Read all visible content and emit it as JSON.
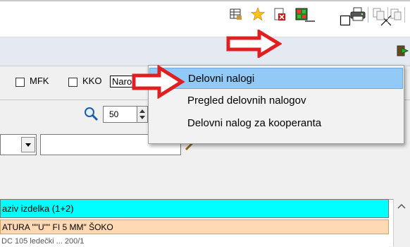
{
  "window": {
    "minimize_icon": "minimize-icon",
    "maximize_icon": "maximize-icon",
    "close_icon": "close-icon"
  },
  "toolbar": {
    "icons": [
      "table-settings-icon",
      "favorite-star-icon",
      "delete-document-icon",
      "grid-color-icon",
      "printer-icon",
      "copy-icon",
      "paste-icon",
      "exit-icon"
    ]
  },
  "filters": {
    "mfk_label": "MFK",
    "kko_label": "KKO",
    "narocil_label": "Naročil"
  },
  "zoom": {
    "value": "50"
  },
  "table": {
    "header": "aziv izdelka (1+2)",
    "row1": "ATURA  \"\"U\"\" FI 5 MM\" ŠOKO",
    "row2": "      DC 105 ledečki ... 200/1"
  },
  "menu": {
    "items": [
      {
        "label": "Delovni nalogi"
      },
      {
        "label": "Pregled delovnih nalogov"
      },
      {
        "label": "Delovni nalog za kooperanta"
      }
    ]
  },
  "colors": {
    "arrow_red": "#e02020",
    "menu_highlight": "#91c9f7",
    "header_cyan": "#00ffff",
    "row_peach": "#ffd9b3"
  }
}
